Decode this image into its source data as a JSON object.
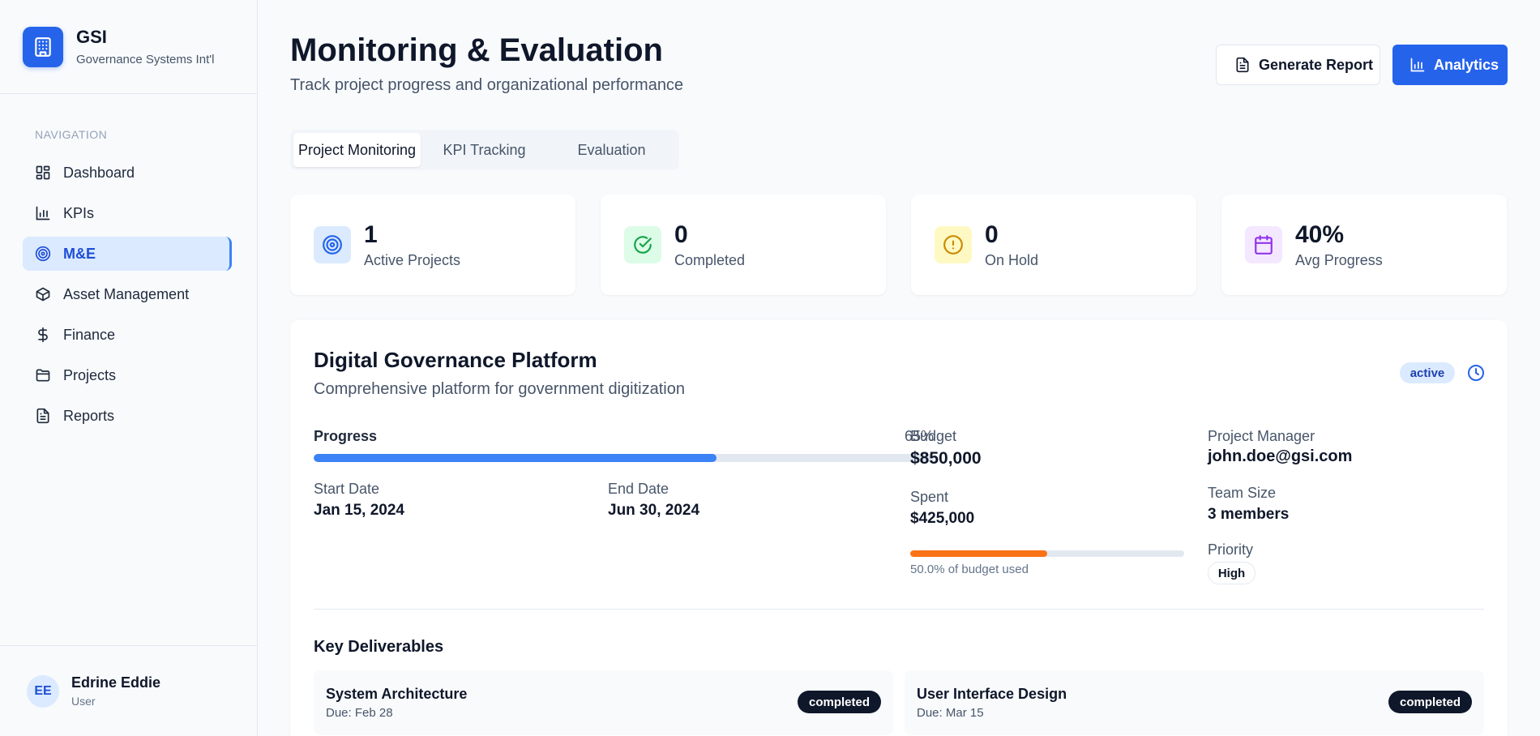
{
  "brand": {
    "name": "GSI",
    "subtitle": "Governance Systems Int'l"
  },
  "sidebar": {
    "heading": "NAVIGATION",
    "items": [
      {
        "label": "Dashboard",
        "icon": "grid-icon",
        "active": false
      },
      {
        "label": "KPIs",
        "icon": "bar-chart-icon",
        "active": false
      },
      {
        "label": "M&E",
        "icon": "target-icon",
        "active": true
      },
      {
        "label": "Asset Management",
        "icon": "box-icon",
        "active": false
      },
      {
        "label": "Finance",
        "icon": "dollar-icon",
        "active": false
      },
      {
        "label": "Projects",
        "icon": "folder-icon",
        "active": false
      },
      {
        "label": "Reports",
        "icon": "file-text-icon",
        "active": false
      }
    ]
  },
  "user": {
    "initials": "EE",
    "name": "Edrine Eddie",
    "role": "User"
  },
  "header": {
    "title": "Monitoring & Evaluation",
    "subtitle": "Track project progress and organizational performance",
    "generate_report_label": "Generate Report",
    "analytics_label": "Analytics"
  },
  "tabs": [
    {
      "label": "Project Monitoring",
      "active": true
    },
    {
      "label": "KPI Tracking",
      "active": false
    },
    {
      "label": "Evaluation",
      "active": false
    }
  ],
  "stats": [
    {
      "value": "1",
      "label": "Active Projects",
      "icon": "target-icon",
      "color": "#2563eb",
      "bg": "#dbeafe"
    },
    {
      "value": "0",
      "label": "Completed",
      "icon": "check-circle-icon",
      "color": "#16a34a",
      "bg": "#dcfce7"
    },
    {
      "value": "0",
      "label": "On Hold",
      "icon": "alert-circle-icon",
      "color": "#ca8a04",
      "bg": "#fef9c3"
    },
    {
      "value": "40%",
      "label": "Avg Progress",
      "icon": "calendar-icon",
      "color": "#9333ea",
      "bg": "#f3e8ff"
    }
  ],
  "project": {
    "title": "Digital Governance Platform",
    "description": "Comprehensive platform for government digitization",
    "status": "active",
    "progress_label": "Progress",
    "progress_text": "65%",
    "progress_value": 0.65,
    "start_label": "Start Date",
    "start_date": "Jan 15, 2024",
    "end_label": "End Date",
    "end_date": "Jun 30, 2024",
    "budget_label": "Budget",
    "budget": "$850,000",
    "spent_label": "Spent",
    "spent": "$425,000",
    "budget_used_value": 0.5,
    "budget_used_text": "50.0% of budget used",
    "manager_label": "Project Manager",
    "manager": "john.doe@gsi.com",
    "team_label": "Team Size",
    "team_size": "3 members",
    "priority_label": "Priority",
    "priority": "High",
    "deliverables_title": "Key Deliverables",
    "deliverables": [
      {
        "name": "System Architecture",
        "due": "Due: Feb 28",
        "status": "completed"
      },
      {
        "name": "User Interface Design",
        "due": "Due: Mar 15",
        "status": "completed"
      }
    ]
  },
  "colors": {
    "accent": "#2563eb",
    "progress": "#3b82f6",
    "budget": "#f97316"
  }
}
